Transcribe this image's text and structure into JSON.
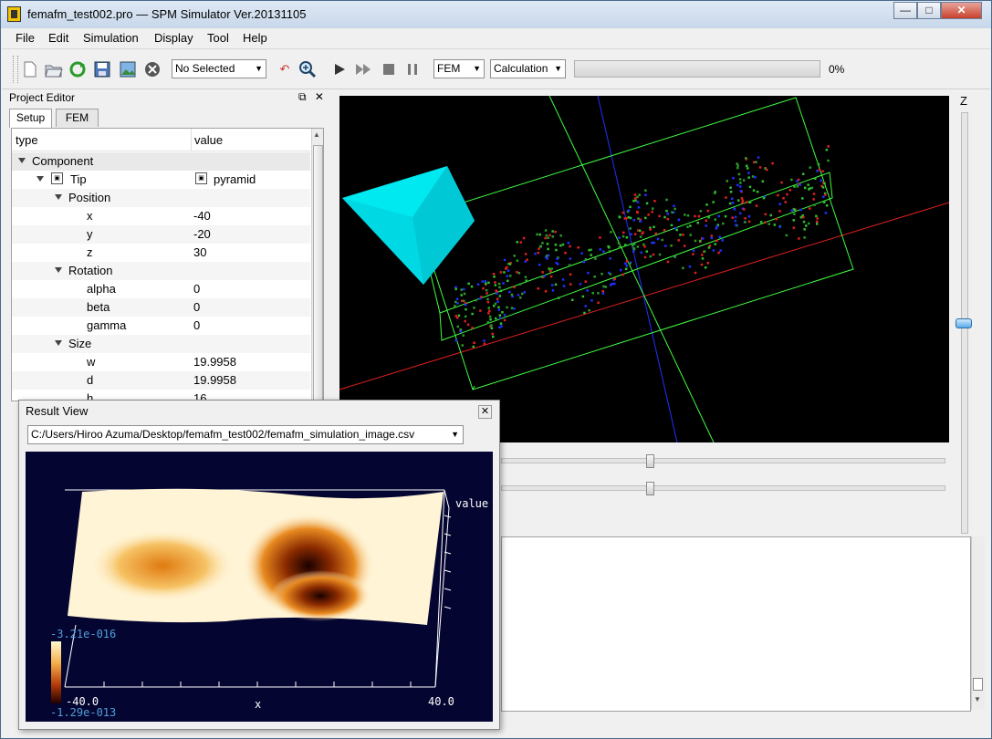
{
  "window": {
    "title": "femafm_test002.pro — SPM Simulator Ver.20131105",
    "min_glyph": "—",
    "max_glyph": "□",
    "close_glyph": "✕"
  },
  "menu": {
    "file": "File",
    "edit": "Edit",
    "simulation": "Simulation",
    "display": "Display",
    "tool": "Tool",
    "help": "Help"
  },
  "toolbar": {
    "icons": [
      "new-file-icon",
      "open-folder-icon",
      "refresh-icon",
      "save-icon",
      "image-icon",
      "stop-circle-icon",
      "undo-icon",
      "zoom-icon",
      "play-icon",
      "fast-forward-icon",
      "stop-icon",
      "pause-icon"
    ],
    "selection_combo": "No Selected",
    "mode_combo": "FEM",
    "calc_combo": "Calculation",
    "progress": 0,
    "progress_label": "0%"
  },
  "project_editor": {
    "title": "Project Editor",
    "float_glyph": "⧉",
    "close_glyph": "✕",
    "tabs": [
      "Setup",
      "FEM"
    ],
    "columns": {
      "type": "type",
      "value": "value"
    },
    "rows": [
      {
        "key": "Component",
        "value": ""
      },
      {
        "key": "Tip",
        "value": "pyramid"
      },
      {
        "key": "Position",
        "value": ""
      },
      {
        "key": "x",
        "value": "-40"
      },
      {
        "key": "y",
        "value": "-20"
      },
      {
        "key": "z",
        "value": "30"
      },
      {
        "key": "Rotation",
        "value": ""
      },
      {
        "key": "alpha",
        "value": "0"
      },
      {
        "key": "beta",
        "value": "0"
      },
      {
        "key": "gamma",
        "value": "0"
      },
      {
        "key": "Size",
        "value": ""
      },
      {
        "key": "w",
        "value": "19.9958"
      },
      {
        "key": "d",
        "value": "19.9958"
      },
      {
        "key": "h",
        "value": "16"
      }
    ]
  },
  "viewport": {
    "z_axis_label": "Z",
    "colors": {
      "x_axis": "#e02020",
      "y_axis": "#2030ff",
      "box": "#40ff40",
      "tip": "#00ffff"
    }
  },
  "result_view": {
    "title": "Result View",
    "close_glyph": "✕",
    "file_path": "C:/Users/Hiroo Azuma/Desktop/femafm_test002/femafm_simulation_image.csv",
    "plot": {
      "value_label": "value",
      "colorbar_max": "-3.21e-016",
      "colorbar_min": "-1.29e-013",
      "x_min": "-40.0",
      "x_max": "40.0",
      "x_label": "x"
    }
  }
}
